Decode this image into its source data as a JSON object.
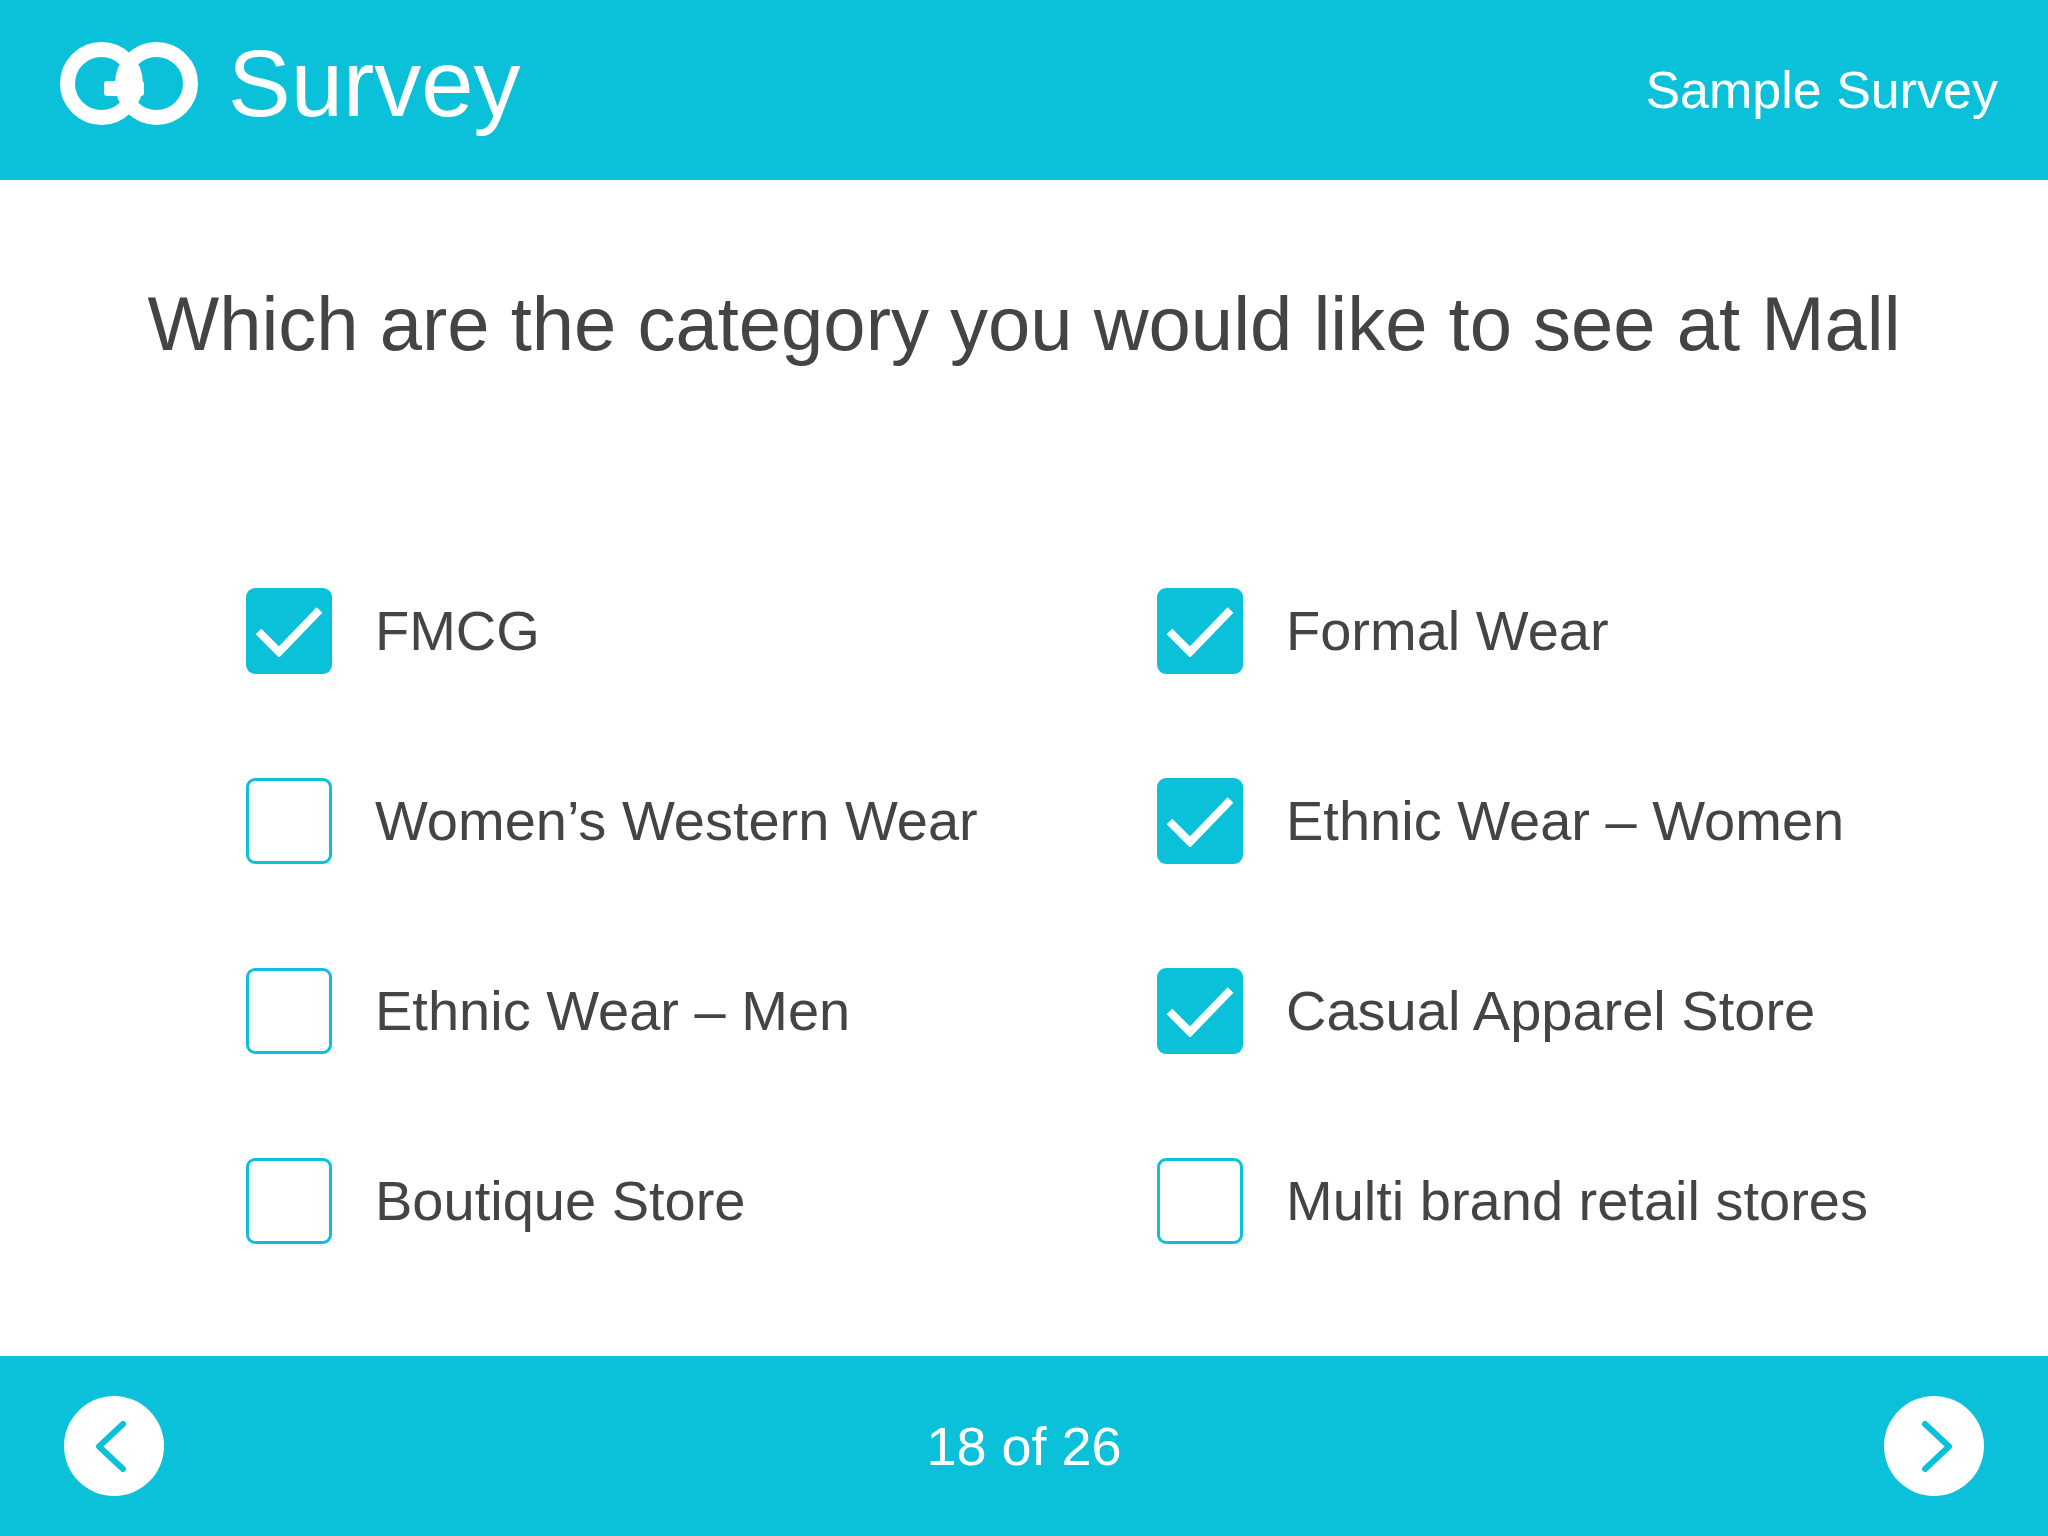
{
  "header": {
    "logo_text": "Survey",
    "survey_title": "Sample Survey"
  },
  "question": "Which are the category you would like to see at Mall",
  "options": [
    {
      "label": "FMCG",
      "checked": true
    },
    {
      "label": "Formal Wear",
      "checked": true
    },
    {
      "label": "Women’s Western Wear",
      "checked": false
    },
    {
      "label": "Ethnic Wear – Women",
      "checked": true
    },
    {
      "label": "Ethnic Wear – Men",
      "checked": false
    },
    {
      "label": "Casual Apparel Store",
      "checked": true
    },
    {
      "label": "Boutique Store",
      "checked": false
    },
    {
      "label": "Multi brand retail stores",
      "checked": false
    }
  ],
  "footer": {
    "progress": "18 of 26"
  }
}
